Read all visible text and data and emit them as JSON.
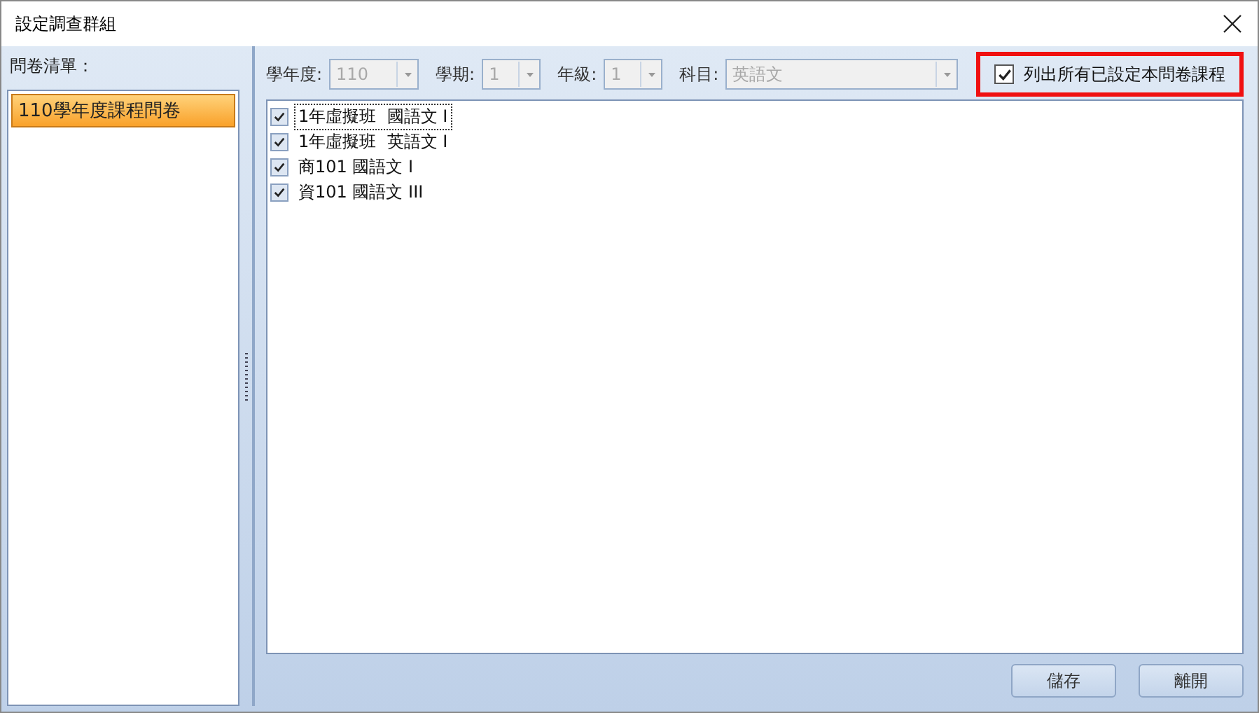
{
  "window": {
    "title": "設定調查群組"
  },
  "sidebar": {
    "label": "問卷清單：",
    "items": [
      {
        "text": "110學年度課程問卷",
        "selected": true
      }
    ]
  },
  "filters": [
    {
      "label": "學年度:",
      "value": "110",
      "disabled": true
    },
    {
      "label": "學期:",
      "value": "1",
      "disabled": true
    },
    {
      "label": "年級:",
      "value": "1",
      "disabled": true
    },
    {
      "label": "科目:",
      "value": "英語文",
      "disabled": true
    }
  ],
  "list_all": {
    "label": "列出所有已設定本問卷課程",
    "checked": true,
    "highlighted": true
  },
  "courses": [
    {
      "text": "1年虛擬班  國語文 I",
      "checked": true,
      "focused": true
    },
    {
      "text": "1年虛擬班  英語文 I",
      "checked": true,
      "focused": false
    },
    {
      "text": "商101 國語文 I",
      "checked": true,
      "focused": false
    },
    {
      "text": "資101 國語文 III",
      "checked": true,
      "focused": false
    }
  ],
  "buttons": [
    "儲存",
    "離開"
  ]
}
